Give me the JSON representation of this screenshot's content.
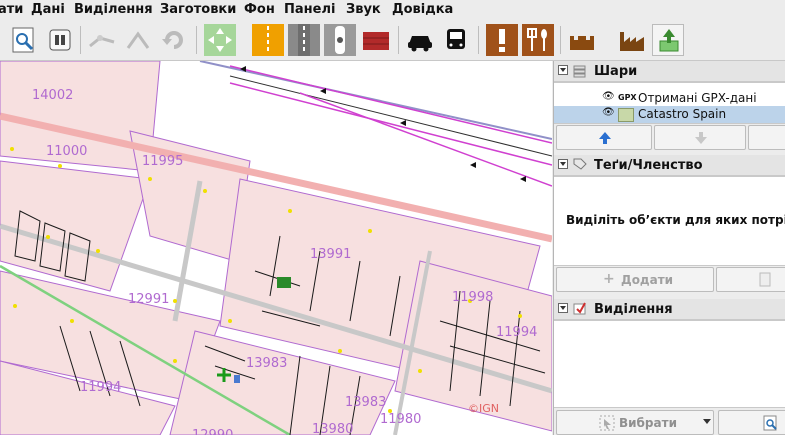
{
  "menu": [
    "ати",
    "Дані",
    "Виділення",
    "Заготовки",
    "Фон",
    "Панелі",
    "Звук",
    "Довідка"
  ],
  "toolbar_icons": [
    "zoom-icon",
    "download-icon",
    "split-way-icon",
    "combine-way-icon",
    "refresh-icon",
    "map-fit-icon",
    "road-yellow-icon",
    "road-grey-icon",
    "path-icon",
    "wall-icon",
    "car-icon",
    "bus-icon",
    "warning-icon",
    "restaurant-icon",
    "castle-icon",
    "factory-icon",
    "upload-icon"
  ],
  "layers_panel": {
    "title": "Шари",
    "layers": [
      {
        "badge": "GPX",
        "name": "Отримані GPX-дані"
      },
      {
        "badge": "",
        "name": "Catastro Spain"
      }
    ]
  },
  "tags_panel": {
    "title": "Теґи/Членство",
    "message": "Виділіть об’єкти для яких потрі",
    "add_label": "Додати"
  },
  "selection_panel": {
    "title": "Виділення",
    "select_label": "Вибрати"
  },
  "map": {
    "labels": [
      "14002",
      "11000",
      "11995",
      "13991",
      "12991",
      "11998",
      "11994",
      "13983",
      "11994",
      "13983",
      "11980",
      "13980",
      "12990"
    ],
    "watermark": "©IGN"
  }
}
